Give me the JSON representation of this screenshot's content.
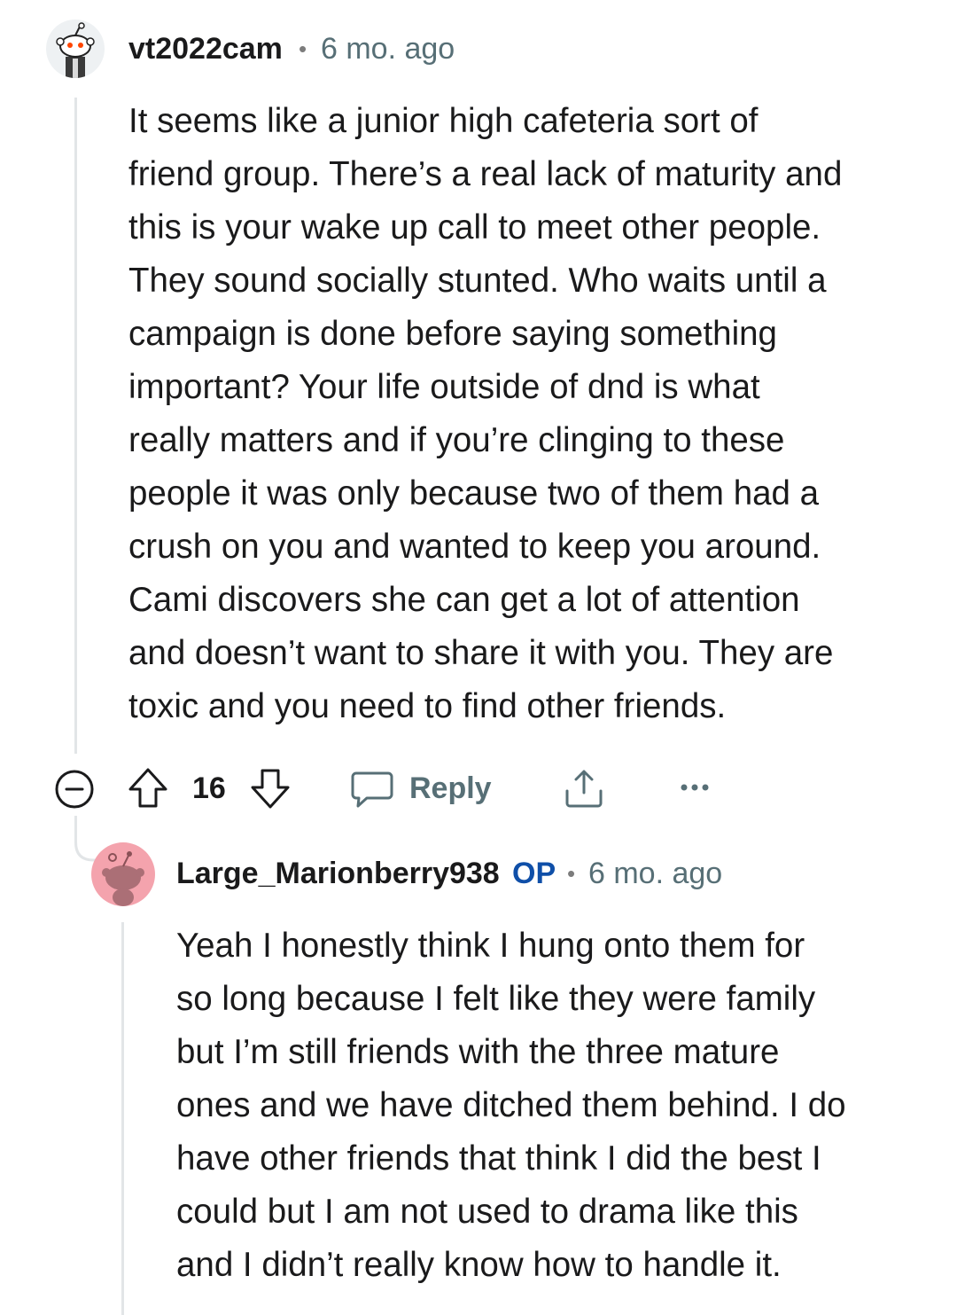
{
  "comment": {
    "username": "vt2022cam",
    "separator": "•",
    "time": "6 mo. ago",
    "avatar_icon": "snoo-avatar-icon",
    "body_lines": [
      "It seems like a junior high cafeteria sort of",
      "friend group. There’s a real lack of maturity and",
      "this is your wake up call to meet other people.",
      "They sound socially stunted. Who waits until a",
      "campaign is done before saying something",
      "important? Your life outside of dnd is what",
      "really matters and if you’re clinging to these",
      "people it was only because two of them had a",
      "crush on you and wanted to keep you around.",
      "Cami discovers she can get a lot of attention",
      "and doesn’t want to share it with you. They are",
      "toxic and you need to find other friends."
    ],
    "actions": {
      "collapse_icon": "collapse-minus-icon",
      "upvote_icon": "upvote-arrow-icon",
      "score": "16",
      "downvote_icon": "downvote-arrow-icon",
      "reply_icon": "chat-bubble-icon",
      "reply_label": "Reply",
      "share_icon": "share-icon",
      "more_icon": "more-dots-icon"
    }
  },
  "reply": {
    "username": "Large_Marionberry938",
    "op_badge": "OP",
    "separator": "•",
    "time": "6 mo. ago",
    "avatar_icon": "snoo-avatar-icon",
    "avatar_color": "#f4a3ad",
    "body_lines": [
      "Yeah I honestly think I hung onto them for",
      "so long because I felt like they were family",
      "but I’m still friends with the three mature",
      "ones and we have ditched them behind. I do",
      "have other friends that think I did the best I",
      "could but I am not used to drama like this",
      "and I didn’t really know how to handle it."
    ]
  },
  "colors": {
    "text": "#1a1a1b",
    "meta": "#576f76",
    "op": "#0f4fa8",
    "thread_line": "#e2e5e7"
  }
}
